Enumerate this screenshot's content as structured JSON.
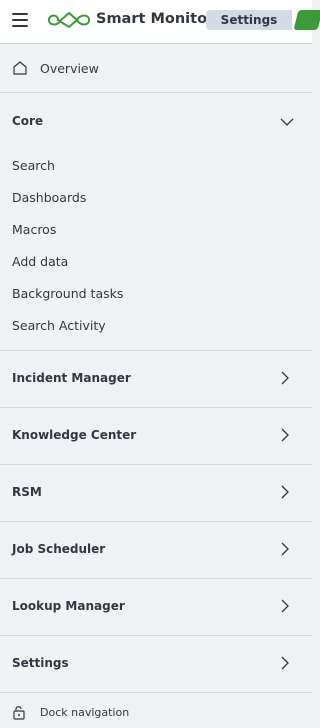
{
  "header": {
    "app_title": "Smart Monitor",
    "settings_label": "Settings",
    "menu_icon": "hamburger-icon",
    "logo_icon": "infinity-logo",
    "accent_color": "#3c9a3b"
  },
  "overview": {
    "label": "Overview",
    "icon": "home-icon"
  },
  "core": {
    "title": "Core",
    "expanded": true,
    "items": [
      {
        "label": "Search"
      },
      {
        "label": "Dashboards"
      },
      {
        "label": "Macros"
      },
      {
        "label": "Add data"
      },
      {
        "label": "Background tasks"
      },
      {
        "label": "Search Activity"
      }
    ]
  },
  "sections": [
    {
      "title": "Incident Manager"
    },
    {
      "title": "Knowledge Center"
    },
    {
      "title": "RSM"
    },
    {
      "title": "Job Scheduler"
    },
    {
      "title": "Lookup Manager"
    },
    {
      "title": "Settings"
    }
  ],
  "dock": {
    "label": "Dock navigation",
    "icon": "lock-icon"
  }
}
